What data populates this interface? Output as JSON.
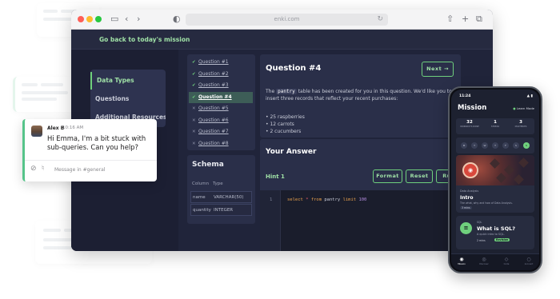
{
  "browser": {
    "url": "enki.com"
  },
  "nav": {
    "back_link": "Go back to today's mission",
    "items": [
      {
        "label": "Data Types",
        "active": true
      },
      {
        "label": "Questions",
        "active": false
      },
      {
        "label": "Additional Resources",
        "active": false
      }
    ]
  },
  "questions": [
    {
      "label": "Question #1",
      "status": "done"
    },
    {
      "label": "Question #2",
      "status": "done"
    },
    {
      "label": "Question #3",
      "status": "done"
    },
    {
      "label": "Question #4",
      "status": "current"
    },
    {
      "label": "Question #5",
      "status": "todo"
    },
    {
      "label": "Question #6",
      "status": "todo"
    },
    {
      "label": "Question #7",
      "status": "todo"
    },
    {
      "label": "Question #8",
      "status": "todo"
    }
  ],
  "schema": {
    "title": "Schema",
    "col_header": "Column",
    "type_header": "Type",
    "rows": [
      {
        "column": "name",
        "type": "VARCHAR(50)"
      },
      {
        "column": "quantity",
        "type": "INTEGER"
      }
    ]
  },
  "question": {
    "title": "Question #4",
    "next_label": "Next →",
    "desc_pre": "The",
    "table_name": "pantry",
    "desc_post": "table has been created for you in this question. We'd like you to insert three records that reflect your recent purchases:",
    "bullets": [
      "• 25 raspberries",
      "• 12 carrots",
      "• 2 cucumbers"
    ]
  },
  "answer": {
    "title": "Your Answer",
    "hint": "Hint 1",
    "format_label": "Format",
    "reset_label": "Reset",
    "run_label": "Run",
    "line_no": "1",
    "code": {
      "select": "select",
      "star": "*",
      "from": "from",
      "table": "pantry",
      "limit": "limit",
      "num": "100"
    }
  },
  "slack": {
    "user": "Alex B",
    "time": "10:16 AM",
    "message": "Hi Emma, I'm a bit stuck with sub-queries. Can you help?",
    "placeholder": "Message in #general"
  },
  "phone": {
    "time": "11:24",
    "status": "▲ ▮",
    "title": "Mission",
    "learn_mode": "Learn Mode",
    "stats": [
      {
        "value": "32",
        "label": "WORKOUTS DONE"
      },
      {
        "value": "1",
        "label": "STREAK"
      },
      {
        "value": "3",
        "label": "MASTERIES"
      }
    ],
    "days": [
      "M",
      "T",
      "W",
      "T",
      "F",
      "S",
      "S"
    ],
    "card1": {
      "subtitle": "Data Analysis",
      "title": "Intro",
      "desc": "The what, why and how of Data Analysis.",
      "pill": "3 mins"
    },
    "card2": {
      "label": "SQL",
      "title": "What is SQL?",
      "desc": "A quick intro to SQL.",
      "meta": "2 mins",
      "badge": "Revision"
    },
    "tabs": [
      {
        "label": "Mission",
        "icon": "◉"
      },
      {
        "label": "Discover",
        "icon": "◎"
      },
      {
        "label": "Code",
        "icon": "◇"
      },
      {
        "label": "Account",
        "icon": "○"
      }
    ]
  },
  "colors": {
    "accent": "#6fd07d",
    "panel": "#2a2f49",
    "background": "#20243a"
  }
}
